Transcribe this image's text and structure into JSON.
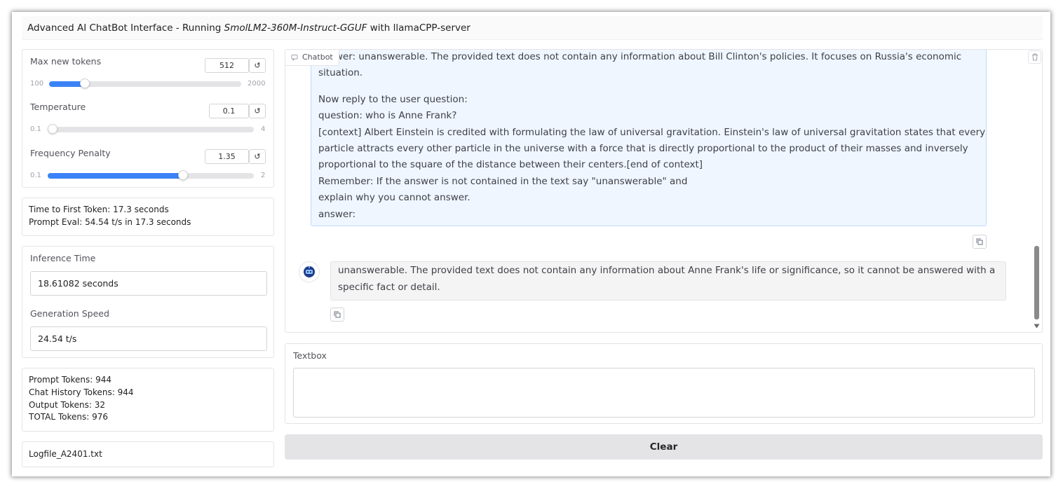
{
  "app": {
    "title_prefix": "Advanced AI ChatBot Interface - Running ",
    "title_model": "SmolLM2-360M-Instruct-GGUF",
    "title_suffix": " with llamaCPP-server"
  },
  "sliders": [
    {
      "label": "Max new tokens",
      "value": "512",
      "min": "100",
      "max": "2000",
      "position": 0.185
    },
    {
      "label": "Temperature",
      "value": "0.1",
      "min": "0.1",
      "max": "4",
      "position": 0.0
    },
    {
      "label": "Frequency Penalty",
      "value": "1.35",
      "min": "0.1",
      "max": "2",
      "position": 0.658
    }
  ],
  "reset_glyph": "↺",
  "timing": {
    "line1": "Time to First Token: 17.3 seconds",
    "line2": "Prompt Eval: 54.54  t/s in 17.3 seconds"
  },
  "inference": {
    "label": "Inference Time",
    "value": "18.61082 seconds"
  },
  "generation": {
    "label": "Generation Speed",
    "value": "24.54  t/s"
  },
  "tokens": {
    "prompt": "Prompt Tokens: 944",
    "history": "Chat History Tokens: 944",
    "output": "Output Tokens: 32",
    "total": "TOTAL Tokens: 976"
  },
  "logfile": "Logfile_A2401.txt",
  "chatbot": {
    "tag": "Chatbot",
    "user_lines": [
      "answer: unanswerable. The provided text does not contain any information about Bill Clinton's policies. It focuses on Russia's economic",
      "situation.",
      "Now reply to the user question:",
      "question: who is Anne Frank?",
      "[context] Albert Einstein is credited with formulating the law of universal gravitation. Einstein's law of universal gravitation states that every",
      "particle attracts every other particle in the universe with a force that is directly proportional to the product of their masses and inversely",
      "proportional to the square of the distance between their centers.[end of context]",
      "Remember: If the answer is not contained in the text say \"unanswerable\" and",
      "explain why you cannot answer.",
      "answer:"
    ],
    "bot_lines": [
      "unanswerable. The provided text does not contain any information about Anne Frank's life or significance, so it cannot be answered with a",
      "specific fact or detail."
    ]
  },
  "textbox": {
    "label": "Textbox",
    "value": ""
  },
  "clear_label": "Clear",
  "colors": {
    "accent": "#3b82f6",
    "user_bubble": "#eff6ff",
    "bot_bubble": "#f4f4f5"
  }
}
